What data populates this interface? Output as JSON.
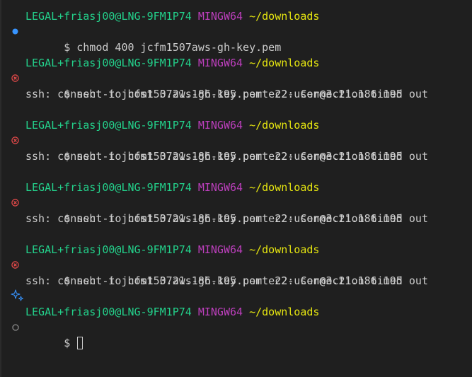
{
  "colors": {
    "background": "#1f1f1f",
    "text": "#cccccc",
    "user": "#23d18b",
    "msystem": "#bc3fbc",
    "cwd": "#e5e510",
    "success_decoration": "#3794ff",
    "error_decoration": "#f14c4c",
    "default_decoration": "#8b8b8b"
  },
  "prompt": {
    "user_host": "LEGAL+friasj00@LNG-9FM1P74",
    "msystem": "MINGW64",
    "cwd": "~/downloads",
    "symbol": "$"
  },
  "blocks": [
    {
      "decoration": "success-dot-icon",
      "command": "chmod 400 jcfm1507aws-gh-key.pem",
      "output": ""
    },
    {
      "decoration": "error-circle-x-icon",
      "command": "ssh -i jcfm1507aws-gh-key.pem ec2-user@3.21.186.195",
      "output": "ssh: connect to host 3.21.186.195 port 22: Connection timed out"
    },
    {
      "decoration": "error-circle-x-icon",
      "command": "ssh -i jcfm1507aws-gh-key.pem ec2-user@3.21.186.195",
      "output": "ssh: connect to host 3.21.186.195 port 22: Connection timed out"
    },
    {
      "decoration": "error-circle-x-icon",
      "command": "ssh -i jcfm1507aws-gh-key.pem ec2-user@3.21.186.195",
      "output": "ssh: connect to host 3.21.186.195 port 22: Connection timed out"
    },
    {
      "decoration": "error-circle-x-icon",
      "command": "ssh -i jcfm1507aws-gh-key.pem ec2-user@3.21.186.195",
      "output": "ssh: connect to host 3.21.186.195 port 22: Connection timed out"
    },
    {
      "decoration": "empty-circle-icon",
      "command": "",
      "output": ""
    }
  ],
  "sparkle_icon": "sparkle-icon"
}
